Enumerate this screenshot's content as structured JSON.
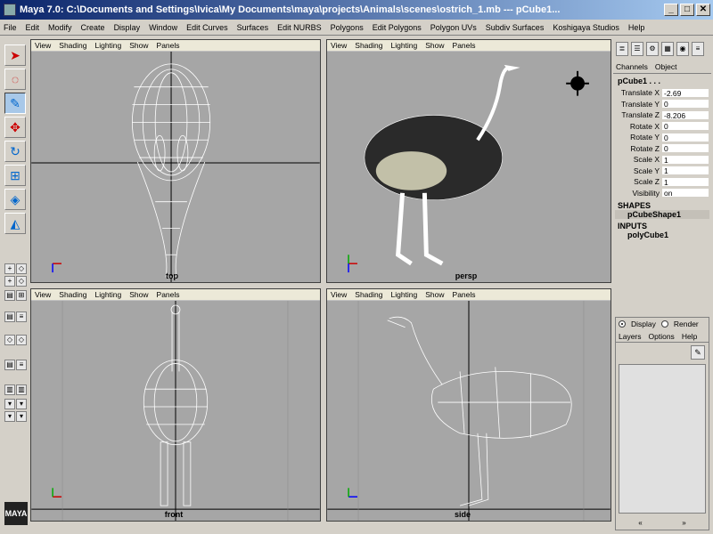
{
  "window": {
    "title": "Maya 7.0: C:\\Documents and Settings\\Ivica\\My Documents\\maya\\projects\\Animals\\scenes\\ostrich_1.mb   ---   pCube1...",
    "minimize": "_",
    "maximize": "□",
    "close": "✕"
  },
  "menubar": [
    "File",
    "Edit",
    "Modify",
    "Create",
    "Display",
    "Window",
    "Edit Curves",
    "Surfaces",
    "Edit NURBS",
    "Polygons",
    "Edit Polygons",
    "Polygon UVs",
    "Subdiv Surfaces",
    "Koshigaya Studios",
    "Help"
  ],
  "viewport_menu": [
    "View",
    "Shading",
    "Lighting",
    "Show",
    "Panels"
  ],
  "viewports": {
    "top": {
      "label": "top"
    },
    "persp": {
      "label": "persp"
    },
    "front": {
      "label": "front"
    },
    "side": {
      "label": "side"
    }
  },
  "logo": "MAYA",
  "channel_box": {
    "tabs": [
      "Channels",
      "Object"
    ],
    "object_name": "pCube1 . . .",
    "attributes": [
      {
        "name": "Translate X",
        "value": "-2.69"
      },
      {
        "name": "Translate Y",
        "value": "0"
      },
      {
        "name": "Translate Z",
        "value": "-8.206"
      },
      {
        "name": "Rotate X",
        "value": "0"
      },
      {
        "name": "Rotate Y",
        "value": "0"
      },
      {
        "name": "Rotate Z",
        "value": "0"
      },
      {
        "name": "Scale X",
        "value": "1"
      },
      {
        "name": "Scale Y",
        "value": "1"
      },
      {
        "name": "Scale Z",
        "value": "1"
      },
      {
        "name": "Visibility",
        "value": "on"
      }
    ],
    "shapes_header": "SHAPES",
    "shape_name": "pCubeShape1",
    "inputs_header": "INPUTS",
    "input_name": "polyCube1"
  },
  "layer_editor": {
    "display_label": "Display",
    "render_label": "Render",
    "menu": [
      "Layers",
      "Options",
      "Help"
    ],
    "scroll_left": "«",
    "scroll_right": "»"
  }
}
